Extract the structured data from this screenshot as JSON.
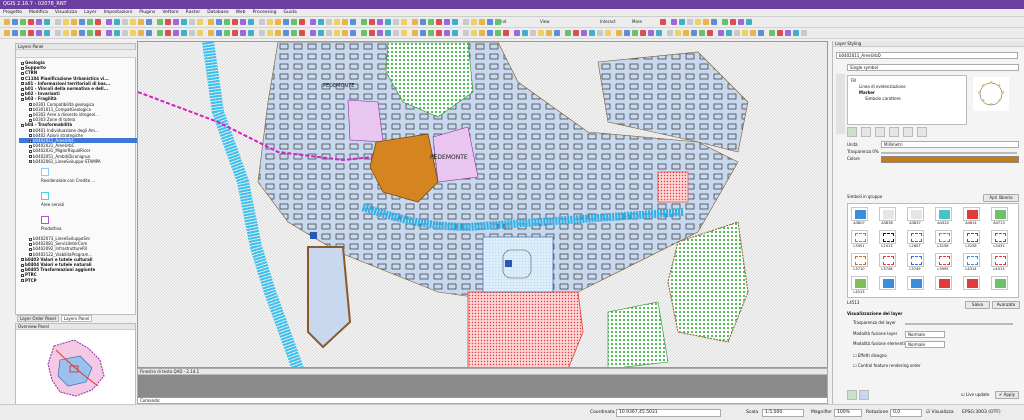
{
  "window": {
    "title": "QGIS 2.16.7 - 02078_RNT"
  },
  "menu": [
    "Progetto",
    "Modifica",
    "Visualizza",
    "Layer",
    "Impostazioni",
    "Plugins",
    "Vettore",
    "Raster",
    "Database",
    "Web",
    "Processing",
    "Guida"
  ],
  "toolbar": {
    "find": "Find",
    "view": "View",
    "interact": "Interact",
    "more": "More"
  },
  "layers_panel": {
    "title": "Layers Panel",
    "items": [
      {
        "label": "Geologia",
        "bold": true
      },
      {
        "label": "Supporto",
        "bold": true
      },
      {
        "label": "CTRN",
        "bold": true
      },
      {
        "label": "C1104 Pianificazione Urbanistica vi...",
        "bold": true
      },
      {
        "label": "a01 - Informazioni territoriali di bas...",
        "bold": true
      },
      {
        "label": "b01 - Vincoli della normativa e dell...",
        "bold": true
      },
      {
        "label": "b02 - Invarianti",
        "bold": true
      },
      {
        "label": "b03 - Fragilità",
        "bold": true
      },
      {
        "label": "b0301 Compatibilità geologica",
        "bold": false
      },
      {
        "label": "b0301011_CompatGeologica",
        "bold": false
      },
      {
        "label": "b0302 Aree a dissesto idrogeol...",
        "bold": false
      },
      {
        "label": "b0303 Zone di tutela",
        "bold": false
      },
      {
        "label": "b04 - Trasformabilità",
        "bold": true
      },
      {
        "label": "b0401 Individuazione degli Am...",
        "bold": false
      },
      {
        "label": "b0402 Azioni strategiche",
        "bold": false
      },
      {
        "label": "b0402011_AreeUrbC",
        "bold": false,
        "selected": true
      },
      {
        "label": "b0402021_AreeUrbC",
        "bold": false
      },
      {
        "label": "b0402031_MiglorRiqualRicer",
        "bold": false
      },
      {
        "label": "b0402051_AmbitiDiconigrua",
        "bold": false
      },
      {
        "label": "b0402061_LineeSviluppo-STAMPA",
        "bold": false
      }
    ],
    "legend": [
      {
        "label": "Residenziale con Credito ..."
      },
      {
        "label": "Aree servizi"
      },
      {
        "label": "Produttiva"
      }
    ],
    "items2": [
      {
        "label": "b0402073_LineeSviluppoSre",
        "bold": false
      },
      {
        "label": "b0402081_ServiziInterCom",
        "bold": false
      },
      {
        "label": "b0402092_InfrastruttureRil",
        "bold": false
      },
      {
        "label": "b0402122_ViabilitaProgram...",
        "bold": false
      },
      {
        "label": "b0403 Valori e tutele culturali",
        "bold": true
      },
      {
        "label": "b0404 Valori e tutele naturali",
        "bold": true
      },
      {
        "label": "b0405 Trasformazioni aggiunte",
        "bold": true
      },
      {
        "label": "PTRC",
        "bold": true
      },
      {
        "label": "PTCP",
        "bold": true
      }
    ]
  },
  "left_tabs": [
    "Layer Order Panel",
    "Layers Panel"
  ],
  "overview": {
    "title": "Overview Panel"
  },
  "map": {
    "label": "PEDEMONTE",
    "label2": "PEDEMONTE"
  },
  "console": {
    "title": "Finestra di testo QAD - 2.14.1",
    "prompt": "Comando:"
  },
  "status": {
    "coord_label": "Coordinata",
    "coord_value": "10.9367,45.5031",
    "scale_label": "Scala",
    "scale_value": "1:5.000",
    "magnifier_label": "Magnifier",
    "magnifier_value": "100%",
    "rotation_label": "Rotazione",
    "rotation_value": "0,0",
    "render_label": "Visualizza",
    "crs": "EPSG:3003 (OTF)"
  },
  "styling": {
    "title": "Layer Styling",
    "layer_select": "b0402011_AreeUrbD",
    "renderer": "Single symbol",
    "tree": [
      "Fill",
      "Linea di evidenziazione",
      "Marker",
      "Simbolo carattere"
    ],
    "unit_label": "Unità",
    "unit_value": "Millimetri",
    "transparency_label": "Trasparenza 0%",
    "color_label": "Colore",
    "color_value": "#c77a1a",
    "group_label": "Simboli in gruppo",
    "open_library": "Apri libreria",
    "symbols": [
      {
        "name": "A3807",
        "color": "#3b8fd8"
      },
      {
        "name": "A3836",
        "color": "#e5e5e5"
      },
      {
        "name": "A3837",
        "color": "#e5e5e5"
      },
      {
        "name": "A4324",
        "color": "#48c2c8"
      },
      {
        "name": "A4631",
        "color": "#e03a3a"
      },
      {
        "name": "A4713",
        "color": "#6ec06e"
      },
      {
        "name": "L3901",
        "color": "#c2722a"
      },
      {
        "name": "L2013",
        "color": "#1a1a1a"
      },
      {
        "name": "L2607",
        "color": "#8a5a2a"
      },
      {
        "name": "L3158",
        "color": "#c2722a"
      },
      {
        "name": "L3258",
        "color": "#555555"
      },
      {
        "name": "L3431",
        "color": "#2a8a2a"
      },
      {
        "name": "L3710",
        "color": "#c2722a"
      },
      {
        "name": "L3746",
        "color": "#e03a3a"
      },
      {
        "name": "L3749",
        "color": "#3b6ad8"
      },
      {
        "name": "L3995",
        "color": "#e03a3a"
      },
      {
        "name": "L4314",
        "color": "#3b8fd8"
      },
      {
        "name": "L4513",
        "color": "#e03a3a"
      },
      {
        "name": "L4513",
        "color": "#7abf5a"
      },
      {
        "name": "",
        "color": "#3b8fd8"
      },
      {
        "name": "",
        "color": "#3b8fd8"
      },
      {
        "name": "",
        "color": "#e03a3a"
      },
      {
        "name": "",
        "color": "#e03a3a"
      },
      {
        "name": "",
        "color": "#6ec06e"
      }
    ],
    "selected_name": "L4513",
    "save": "Salva",
    "advanced": "Avanzato",
    "layer_render_title": "Visualizzazione del layer",
    "layer_transparency": "Trasparenza del layer",
    "blend_layer_label": "Modalità fusione layer",
    "blend_layer_value": "Normale",
    "blend_feat_label": "Modalità fusione elementi",
    "blend_feat_value": "Normale",
    "effects": "Effetti disegno",
    "control_order": "Control feature rendering order",
    "live_update": "Live update",
    "apply": "Apply"
  }
}
